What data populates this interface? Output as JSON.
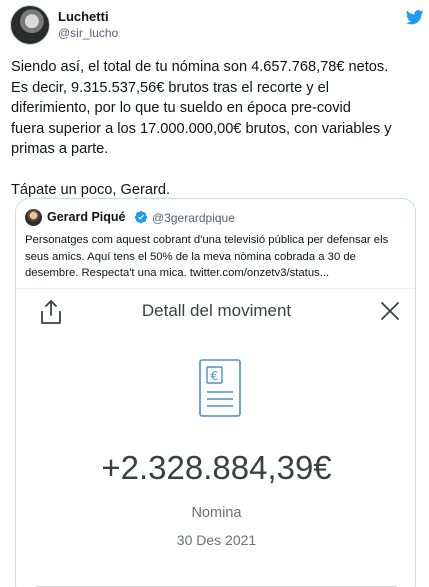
{
  "author": {
    "name": "Luchetti",
    "handle": "@sir_lucho"
  },
  "tweet": {
    "lines": [
      "Siendo así, el total de tu nómina son 4.657.768,78€ netos.",
      "Es decir, 9.315.537,56€ brutos tras el recorte y el",
      "diferimiento, por lo que tu sueldo en época pre-covid",
      "fuera superior a los 17.000.000,00€ brutos, con variables y",
      "primas a parte."
    ],
    "closing": "Tápate un poco, Gerard."
  },
  "quote": {
    "name": "Gerard Piqué",
    "handle": "@3gerardpique",
    "lines": [
      "Personatges com aquest cobrant d'una televisió pública per defensar els",
      "seus amics. Aquí tens el 50% de la meva nòmina cobrada a 30 de",
      "desembre. Respecta't una mica. twitter.com/onzetv3/status..."
    ]
  },
  "receipt": {
    "title": "Detall del moviment",
    "amount": "+2.328.884,39€",
    "concept": "Nomina",
    "date": "30 Des 2021",
    "icon_symbol": "€"
  },
  "icons": {
    "brand": "twitter-bird-icon",
    "verified": "verified-badge-icon",
    "share": "share-icon",
    "close": "close-icon",
    "receipt": "receipt-icon"
  },
  "colors": {
    "twitter_blue": "#1d9bf0",
    "text": "#0f1419",
    "secondary": "#536471",
    "receipt_blue": "#4a90c8"
  }
}
